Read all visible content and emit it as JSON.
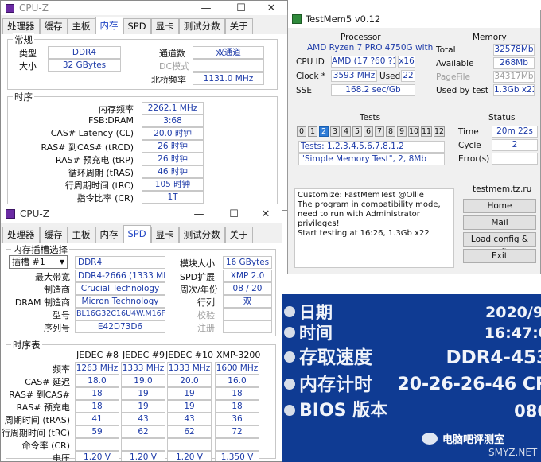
{
  "cpuz1": {
    "title": "CPU-Z",
    "tabs": [
      "处理器",
      "缓存",
      "主板",
      "内存",
      "SPD",
      "显卡",
      "测试分数",
      "关于"
    ],
    "active_tab": "内存",
    "general": {
      "title": "常规",
      "type_label": "类型",
      "type": "DDR4",
      "size_label": "大小",
      "size": "32 GBytes",
      "channels_label": "通道数",
      "channels": "双通道",
      "dc_label": "DC模式",
      "nb_label": "北桥频率",
      "nb": "1131.0 MHz"
    },
    "timings": {
      "title": "时序",
      "rows": [
        {
          "label": "内存频率",
          "value": "2262.1 MHz"
        },
        {
          "label": "FSB:DRAM",
          "value": "3:68"
        },
        {
          "label": "CAS# Latency (CL)",
          "value": "20.0 时钟"
        },
        {
          "label": "RAS# 到CAS# (tRCD)",
          "value": "26 时钟"
        },
        {
          "label": "RAS# 预充电 (tRP)",
          "value": "26 时钟"
        },
        {
          "label": "循环周期 (tRAS)",
          "value": "46 时钟"
        },
        {
          "label": "行周期时间 (tRC)",
          "value": "105 时钟"
        },
        {
          "label": "指令比率 (CR)",
          "value": "1T"
        }
      ]
    }
  },
  "cpuz2": {
    "title": "CPU-Z",
    "tabs": [
      "处理器",
      "缓存",
      "主板",
      "内存",
      "SPD",
      "显卡",
      "测试分数",
      "关于"
    ],
    "active_tab": "SPD",
    "slot": {
      "title": "内存插槽选择",
      "select": "插槽 #1",
      "type": "DDR4",
      "module_size_label": "模块大小",
      "module_size": "16 GBytes",
      "maxbw_label": "最大带宽",
      "maxbw": "DDR4-2666 (1333 MHz)",
      "spd_ext_label": "SPD扩展",
      "spd_ext": "XMP 2.0",
      "mfr_label": "制造商",
      "mfr": "Crucial Technology",
      "week_label": "周次/年份",
      "week": "08 / 20",
      "dram_mfr_label": "DRAM 制造商",
      "dram_mfr": "Micron Technology",
      "rank_label": "行列",
      "rank": "双",
      "part_label": "型号",
      "part": "BL16G32C16U4W.M16FE1",
      "check_label": "校验",
      "serial_label": "序列号",
      "serial": "E42D73D6",
      "reg_label": "注册"
    },
    "table": {
      "title": "时序表",
      "headers": [
        "JEDEC #8",
        "JEDEC #9",
        "JEDEC #10",
        "XMP-3200"
      ],
      "rows": [
        {
          "label": "频率",
          "values": [
            "1263 MHz",
            "1333 MHz",
            "1333 MHz",
            "1600 MHz"
          ]
        },
        {
          "label": "CAS# 延迟",
          "values": [
            "18.0",
            "19.0",
            "20.0",
            "16.0"
          ]
        },
        {
          "label": "RAS# 到CAS#",
          "values": [
            "18",
            "19",
            "19",
            "18"
          ]
        },
        {
          "label": "RAS# 预充电",
          "values": [
            "18",
            "19",
            "19",
            "18"
          ]
        },
        {
          "label": "周期时间 (tRAS)",
          "values": [
            "41",
            "43",
            "43",
            "36"
          ]
        },
        {
          "label": "行周期时间 (tRC)",
          "values": [
            "59",
            "62",
            "62",
            "72"
          ]
        },
        {
          "label": "命令率 (CR)",
          "values": [
            "",
            "",
            "",
            ""
          ]
        },
        {
          "label": "电压",
          "values": [
            "1.20 V",
            "1.20 V",
            "1.20 V",
            "1.350 V"
          ]
        }
      ]
    }
  },
  "testmem": {
    "title": "TestMem5 v0.12",
    "processor": {
      "title": "Processor",
      "name": "AMD Ryzen 7 PRO 4750G with",
      "cpuid_label": "CPU ID",
      "cpuid": "AMD (17 ?60 ?1)",
      "threads": "x16",
      "clock_label": "Clock *",
      "clock": "3593 MHz",
      "used_label": "Used",
      "used": "22",
      "sse_label": "SSE",
      "sse": "168.2 sec/Gb"
    },
    "memory": {
      "title": "Memory",
      "total_label": "Total",
      "total": "32578Mb",
      "avail_label": "Available",
      "avail": "268Mb",
      "pagefile_label": "PageFile",
      "pagefile": "34317Mb",
      "usedby_label": "Used by test",
      "usedby": "1.3Gb x22"
    },
    "tests": {
      "title": "Tests",
      "cells": [
        "0",
        "1",
        "2",
        "3",
        "4",
        "5",
        "6",
        "7",
        "8",
        "9",
        "10",
        "11",
        "12"
      ],
      "active": 2,
      "list": "Tests: 1,2,3,4,5,6,7,8,1,2",
      "current": "\"Simple Memory Test\", 2, 8Mb"
    },
    "status": {
      "title": "Status",
      "time_label": "Time",
      "time": "20m 22s",
      "cycle_label": "Cycle",
      "cycle": "2",
      "errors_label": "Error(s)",
      "errors": ""
    },
    "log": [
      "Customize: FastMemTest @Ollie",
      "The program in compatibility mode,",
      "need to run with Administrator privileges!",
      "Start testing at 16:26, 1.3Gb x22"
    ],
    "site": "testmem.tz.ru",
    "buttons": [
      "Home",
      "Mail",
      "Load config & exit",
      "Exit"
    ]
  },
  "bios": {
    "rows": [
      {
        "key": "日期",
        "value": "2020/9/"
      },
      {
        "key": "时间",
        "value": "16:47:0"
      },
      {
        "key": "存取速度",
        "value": "DDR4-453"
      },
      {
        "key": "内存计时",
        "value": "20-26-26-46 CR"
      },
      {
        "key": "BIOS 版本",
        "value": "080"
      }
    ]
  },
  "watermark": {
    "brand": "电脑吧评测室",
    "site": "SMYZ.NET"
  }
}
